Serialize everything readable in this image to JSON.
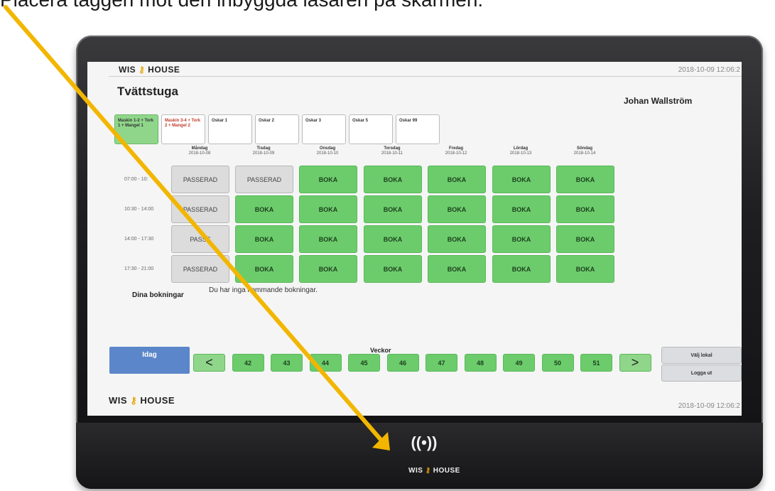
{
  "caption": "Placera taggen mot den inbyggda läsaren på skärmen.",
  "brand": {
    "wis": "WIS",
    "house": "HOUSE",
    "key_glyph": "⚷"
  },
  "header": {
    "date": "2018-10-09 12:06:2",
    "title": "Tvättstuga",
    "user": "Johan Wallström"
  },
  "tabs": [
    {
      "label": "Maskin 1-2 + Tork 1 + Mangel 1",
      "active": true
    },
    {
      "label": "Maskin 3-4 + Tork 2 + Mangel 2",
      "active": false
    },
    {
      "label": "Oskar 1",
      "active": false
    },
    {
      "label": "Oskar 2",
      "active": false
    },
    {
      "label": "Oskar 3",
      "active": false
    },
    {
      "label": "Oskar 5",
      "active": false
    },
    {
      "label": "Oskar 99",
      "active": false
    }
  ],
  "days": [
    {
      "name": "Måndag",
      "date": "2018-10-08"
    },
    {
      "name": "Tisdag",
      "date": "2018-10-09"
    },
    {
      "name": "Onsdag",
      "date": "2018-10-10"
    },
    {
      "name": "Torsdag",
      "date": "2018-10-11"
    },
    {
      "name": "Fredag",
      "date": "2018-10-12"
    },
    {
      "name": "Lördag",
      "date": "2018-10-13"
    },
    {
      "name": "Söndag",
      "date": "2018-10-14"
    }
  ],
  "slots": [
    {
      "time": "07:00 - 10:",
      "cells": [
        "PASSERAD",
        "PASSERAD",
        "BOKA",
        "BOKA",
        "BOKA",
        "BOKA",
        "BOKA"
      ]
    },
    {
      "time": "10:30 - 14:00",
      "cells": [
        "PASSERAD",
        "BOKA",
        "BOKA",
        "BOKA",
        "BOKA",
        "BOKA",
        "BOKA"
      ]
    },
    {
      "time": "14:00 - 17:30",
      "cells": [
        "PASSE",
        "BOKA",
        "BOKA",
        "BOKA",
        "BOKA",
        "BOKA",
        "BOKA"
      ]
    },
    {
      "time": "17:30 - 21:00",
      "cells": [
        "PASSERAD",
        "BOKA",
        "BOKA",
        "BOKA",
        "BOKA",
        "BOKA",
        "BOKA"
      ]
    }
  ],
  "bookings": {
    "label": "Dina bokningar",
    "empty": "Du har inga kommande bokningar."
  },
  "nav": {
    "today": "Idag",
    "weeks_label": "Veckor",
    "prev": "<",
    "next": ">",
    "weeks": [
      "42",
      "43",
      "44",
      "45",
      "46",
      "47",
      "48",
      "49",
      "50",
      "51"
    ]
  },
  "side": {
    "select_room": "Välj lokal",
    "logout": "Logga ut"
  },
  "footer": {
    "date": "2018-10-09 12:06:2"
  },
  "reader": {
    "icon": "nfc-reader-icon",
    "symbol": "((•))"
  },
  "colors": {
    "boka": "#6ccc6c",
    "passerad": "#dcdcdc",
    "today": "#5b86c9",
    "pointer": "#f2b600"
  }
}
